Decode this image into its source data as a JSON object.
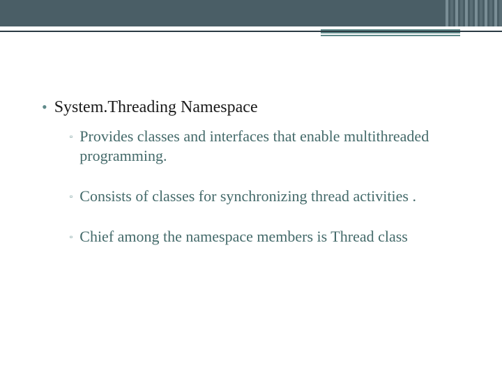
{
  "colors": {
    "header": "#4a5e66",
    "accent": "#5f8a8a",
    "subtext": "#446a6a"
  },
  "slide": {
    "main_item": "System.Threading Namespace",
    "sub_items": [
      "Provides classes and interfaces that enable multithreaded programming.",
      "Consists of classes for synchronizing thread activities .",
      "Chief among the namespace members  is Thread class"
    ]
  }
}
